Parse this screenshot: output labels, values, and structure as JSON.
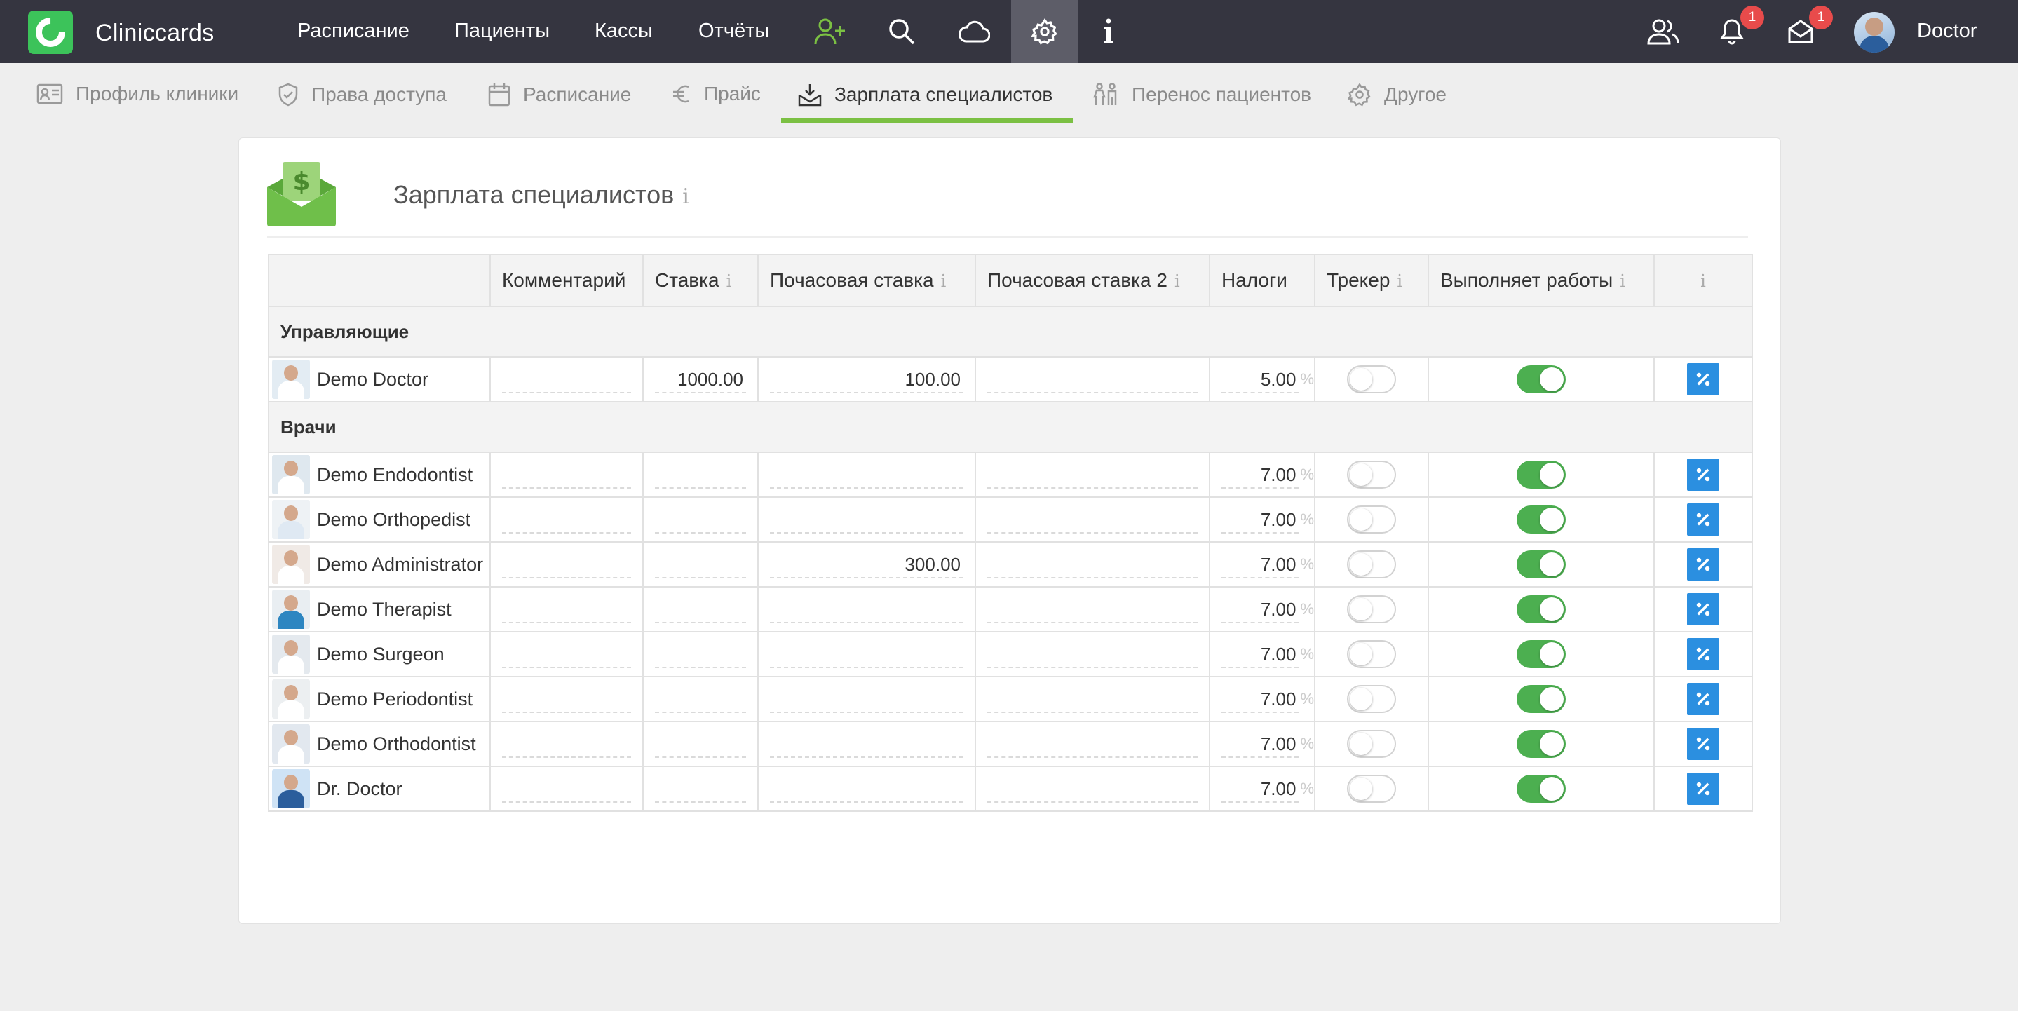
{
  "app": {
    "brand": "Cliniccards",
    "user": "Doctor",
    "notifications_count": "1",
    "messages_count": "1",
    "accent": "#7bc043",
    "topbar_bg": "#353540"
  },
  "nav": [
    {
      "label": "Расписание"
    },
    {
      "label": "Пациенты"
    },
    {
      "label": "Кассы"
    },
    {
      "label": "Отчёты"
    }
  ],
  "subnav": [
    {
      "label": "Профиль клиники",
      "icon": "id-card-icon"
    },
    {
      "label": "Права доступа",
      "icon": "shield-icon"
    },
    {
      "label": "Расписание",
      "icon": "calendar-icon"
    },
    {
      "label": "Прайс",
      "icon": "euro-icon"
    },
    {
      "label": "Зарплата специалистов",
      "icon": "salary-icon",
      "active": true
    },
    {
      "label": "Перенос пациентов",
      "icon": "people-transfer-icon"
    },
    {
      "label": "Другое",
      "icon": "gear-icon"
    }
  ],
  "page": {
    "title": "Зарплата специалистов",
    "info": "i"
  },
  "table": {
    "headers": [
      "",
      "Комментарий",
      "Ставка",
      "Почасовая ставка",
      "Почасовая ставка 2",
      "Налоги",
      "Трекер",
      "Выполняет работы",
      ""
    ],
    "info_mark": "i",
    "percent_sign": "%",
    "groups": [
      {
        "name": "Управляющие",
        "rows": [
          {
            "name": "Demo Doctor",
            "comment": "",
            "rate": "1000.00",
            "hourly": "100.00",
            "hourly2": "",
            "tax": "5.00",
            "tracker": false,
            "works": true
          }
        ]
      },
      {
        "name": "Врачи",
        "rows": [
          {
            "name": "Demo Endodontist",
            "comment": "",
            "rate": "",
            "hourly": "",
            "hourly2": "",
            "tax": "7.00",
            "tracker": false,
            "works": true
          },
          {
            "name": "Demo Orthopedist",
            "comment": "",
            "rate": "",
            "hourly": "",
            "hourly2": "",
            "tax": "7.00",
            "tracker": false,
            "works": true
          },
          {
            "name": "Demo Administrator",
            "comment": "",
            "rate": "",
            "hourly": "300.00",
            "hourly2": "",
            "tax": "7.00",
            "tracker": false,
            "works": true
          },
          {
            "name": "Demo Therapist",
            "comment": "",
            "rate": "",
            "hourly": "",
            "hourly2": "",
            "tax": "7.00",
            "tracker": false,
            "works": true
          },
          {
            "name": "Demo Surgeon",
            "comment": "",
            "rate": "",
            "hourly": "",
            "hourly2": "",
            "tax": "7.00",
            "tracker": false,
            "works": true
          },
          {
            "name": "Demo Periodontist",
            "comment": "",
            "rate": "",
            "hourly": "",
            "hourly2": "",
            "tax": "7.00",
            "tracker": false,
            "works": true
          },
          {
            "name": "Demo Orthodontist",
            "comment": "",
            "rate": "",
            "hourly": "",
            "hourly2": "",
            "tax": "7.00",
            "tracker": false,
            "works": true
          },
          {
            "name": "Dr. Doctor",
            "comment": "",
            "rate": "",
            "hourly": "",
            "hourly2": "",
            "tax": "7.00",
            "tracker": false,
            "works": true
          }
        ]
      }
    ]
  }
}
